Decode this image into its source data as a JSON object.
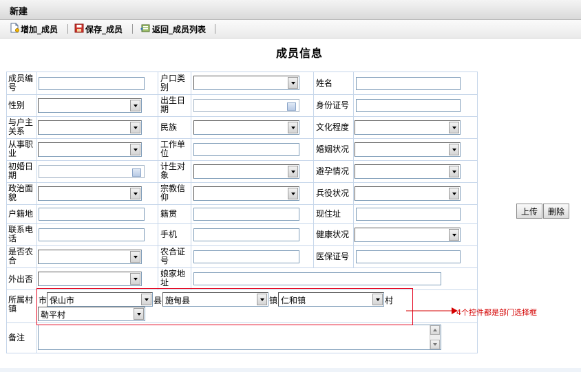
{
  "window": {
    "title": "新建"
  },
  "toolbar": {
    "add_label": "增加_成员",
    "save_label": "保存_成员",
    "back_label": "返回_成员列表"
  },
  "form": {
    "title": "成员信息",
    "labels": {
      "member_no": "成员编号",
      "hukou_type": "户口类别",
      "name": "姓名",
      "gender": "性别",
      "birth_date": "出生日期",
      "id_no": "身份证号",
      "relation": "与户主关系",
      "ethnicity": "民族",
      "education": "文化程度",
      "occupation": "从事职业",
      "work_unit": "工作单位",
      "marital": "婚姻状况",
      "first_marriage": "初婚日期",
      "family_planning": "计生对象",
      "contraception": "避孕情况",
      "political": "政治面貌",
      "religion": "宗教信仰",
      "military": "兵役状况",
      "domicile": "户籍地",
      "native_place": "籍贯",
      "address": "现住址",
      "phone": "联系电话",
      "mobile": "手机",
      "health": "健康状况",
      "rural_coop": "是否农合",
      "coop_no": "农合证号",
      "medical_no": "医保证号",
      "outgoing": "外出否",
      "maiden_address": "娘家地址",
      "village": "所属村镇",
      "remarks": "备注"
    },
    "region": {
      "city_prefix": "市",
      "city_value": "保山市",
      "county_prefix": "县",
      "county_value": "施甸县",
      "town_prefix": "镇",
      "town_value": "仁和镇",
      "village_suffix": "村",
      "village_value": "勒平村"
    }
  },
  "side_buttons": {
    "upload": "上传",
    "delete": "删除"
  },
  "annotation": "4个控件都是部门选择框"
}
